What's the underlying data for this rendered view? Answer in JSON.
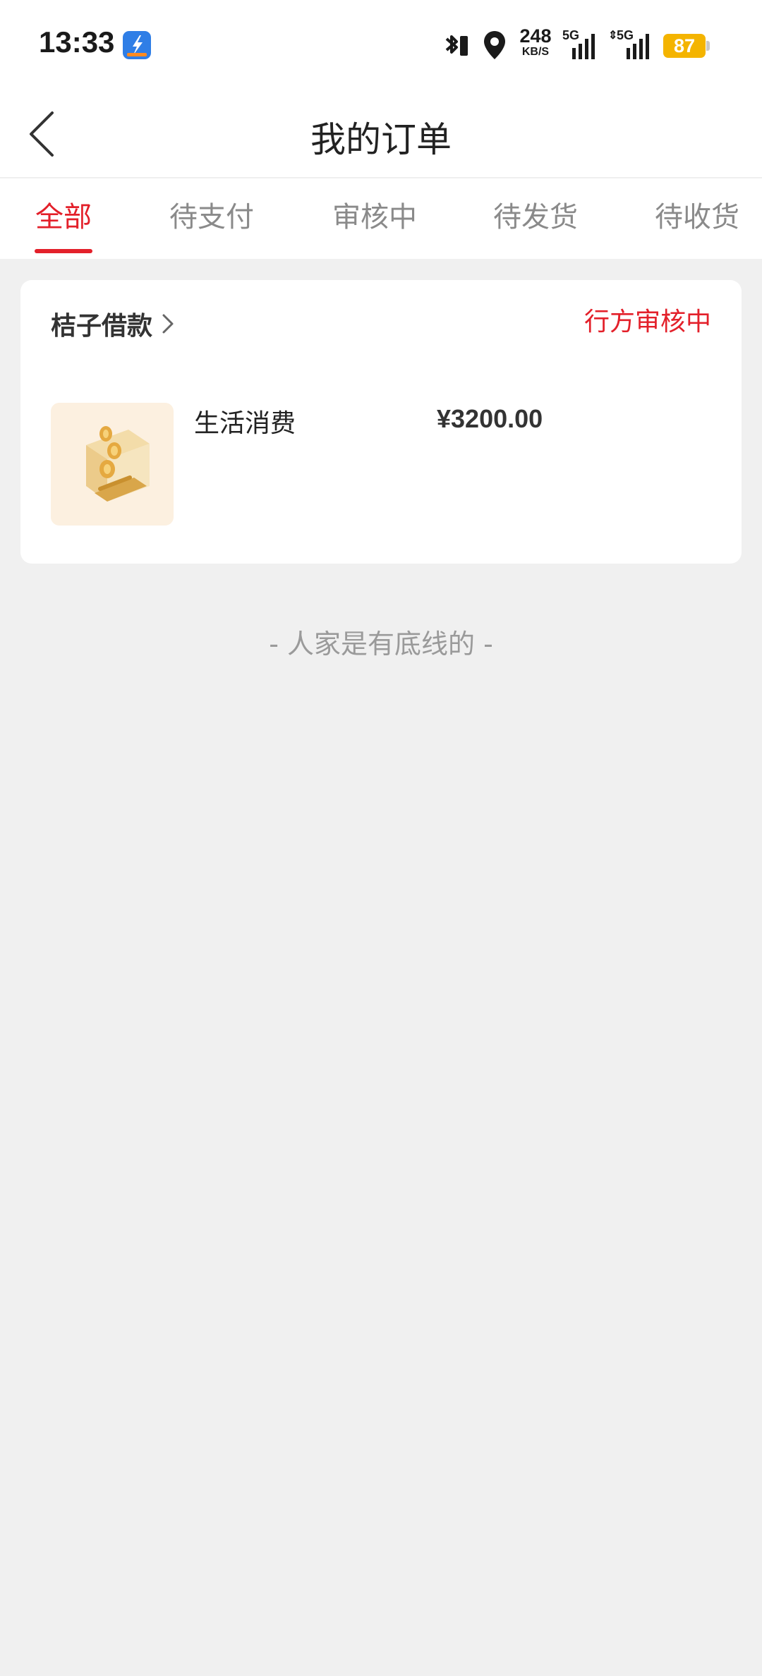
{
  "status_bar": {
    "time": "13:33",
    "net_speed": "248",
    "net_speed_unit": "KB/S",
    "signal_1_label": "5G",
    "signal_2_label": "5G",
    "battery": "87",
    "icons": [
      "app-notification-icon",
      "bluetooth-icon",
      "location-icon",
      "signal-icon",
      "signal-icon",
      "battery-icon"
    ]
  },
  "header": {
    "title": "我的订单",
    "back_icon": "chevron-left-icon"
  },
  "tabs": [
    {
      "label": "全部",
      "active": true
    },
    {
      "label": "待支付",
      "active": false
    },
    {
      "label": "审核中",
      "active": false
    },
    {
      "label": "待发货",
      "active": false
    },
    {
      "label": "待收货",
      "active": false
    }
  ],
  "order": {
    "merchant": "桔子借款",
    "status": "行方审核中",
    "product_name": "生活消费",
    "price": "¥3200.00"
  },
  "end_text": "- 人家是有底线的 -",
  "colors": {
    "accent": "#e3202a",
    "background": "#f0f0f0",
    "card": "#ffffff",
    "battery": "#f4b400"
  }
}
